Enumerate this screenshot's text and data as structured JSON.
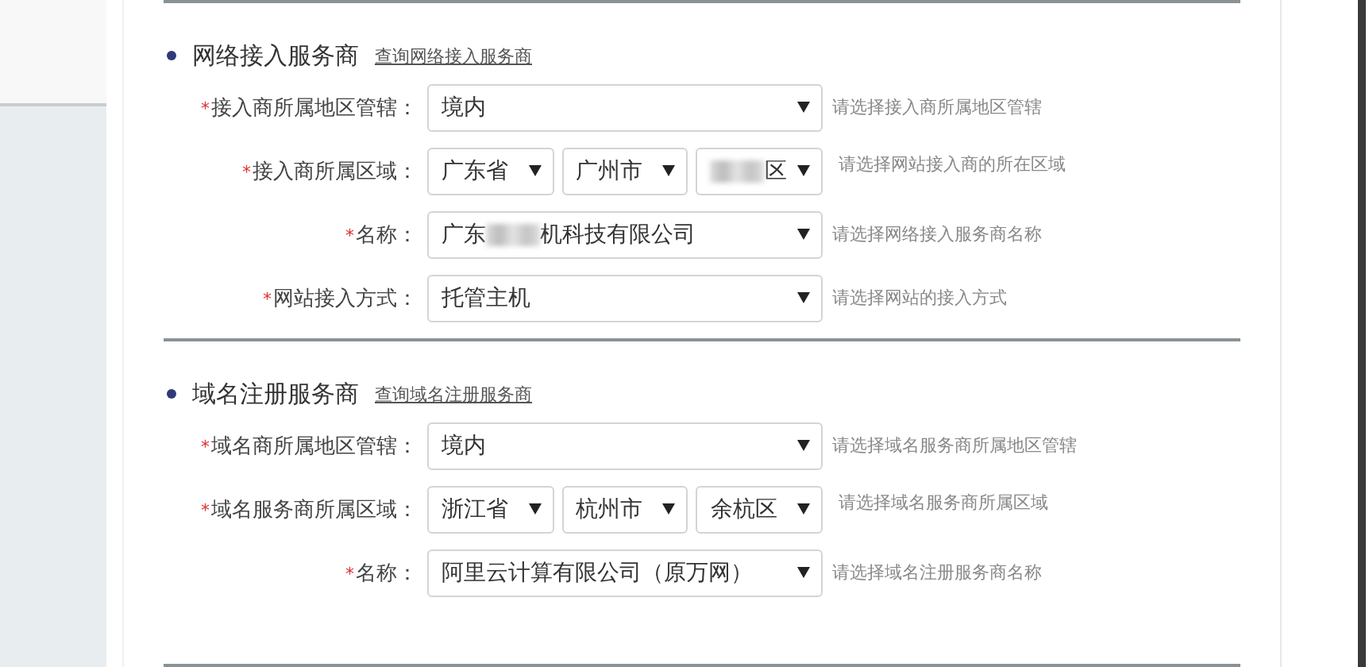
{
  "sections": [
    {
      "title": "网络接入服务商",
      "link": "查询网络接入服务商",
      "rows": [
        {
          "mark": "*",
          "label": "接入商所属地区管辖：",
          "kind": "single",
          "fields": [
            {
              "value": [
                {
                  "kind": "text",
                  "text": "境内"
                }
              ]
            }
          ],
          "hint": "请选择接入商所属地区管辖"
        },
        {
          "mark": "*",
          "label": "接入商所属区域：",
          "kind": "region",
          "fields": [
            {
              "value": [
                {
                  "kind": "text",
                  "text": "广东省"
                }
              ]
            },
            {
              "value": [
                {
                  "kind": "text",
                  "text": "广州市"
                }
              ]
            },
            {
              "value": [
                {
                  "kind": "redacted"
                },
                {
                  "kind": "text",
                  "text": "区"
                }
              ]
            }
          ],
          "hint": "请选择网站接入商的所在区域"
        },
        {
          "mark": "*",
          "label": "名称：",
          "kind": "single",
          "fields": [
            {
              "value": [
                {
                  "kind": "text",
                  "text": "广东"
                },
                {
                  "kind": "redacted"
                },
                {
                  "kind": "text",
                  "text": "机科技有限公司"
                }
              ]
            }
          ],
          "hint": "请选择网络接入服务商名称"
        },
        {
          "mark": "*",
          "label": "网站接入方式：",
          "kind": "single",
          "fields": [
            {
              "value": [
                {
                  "kind": "text",
                  "text": "托管主机"
                }
              ]
            }
          ],
          "hint": "请选择网站的接入方式"
        }
      ]
    },
    {
      "title": "域名注册服务商",
      "link": "查询域名注册服务商",
      "rows": [
        {
          "mark": "*",
          "label": "域名商所属地区管辖：",
          "kind": "single",
          "fields": [
            {
              "value": [
                {
                  "kind": "text",
                  "text": "境内"
                }
              ]
            }
          ],
          "hint": "请选择域名服务商所属地区管辖"
        },
        {
          "mark": "*",
          "label": "域名服务商所属区域：",
          "kind": "region",
          "fields": [
            {
              "value": [
                {
                  "kind": "text",
                  "text": "浙江省"
                }
              ]
            },
            {
              "value": [
                {
                  "kind": "text",
                  "text": "杭州市"
                }
              ]
            },
            {
              "value": [
                {
                  "kind": "text",
                  "text": "余杭区"
                }
              ]
            }
          ],
          "hint": "请选择域名服务商所属区域"
        },
        {
          "mark": "*",
          "label": "名称：",
          "kind": "single",
          "fields": [
            {
              "value": [
                {
                  "kind": "text",
                  "text": "阿里云计算有限公司（原万网）"
                }
              ]
            }
          ],
          "hint": "请选择域名注册服务商名称"
        }
      ]
    }
  ]
}
